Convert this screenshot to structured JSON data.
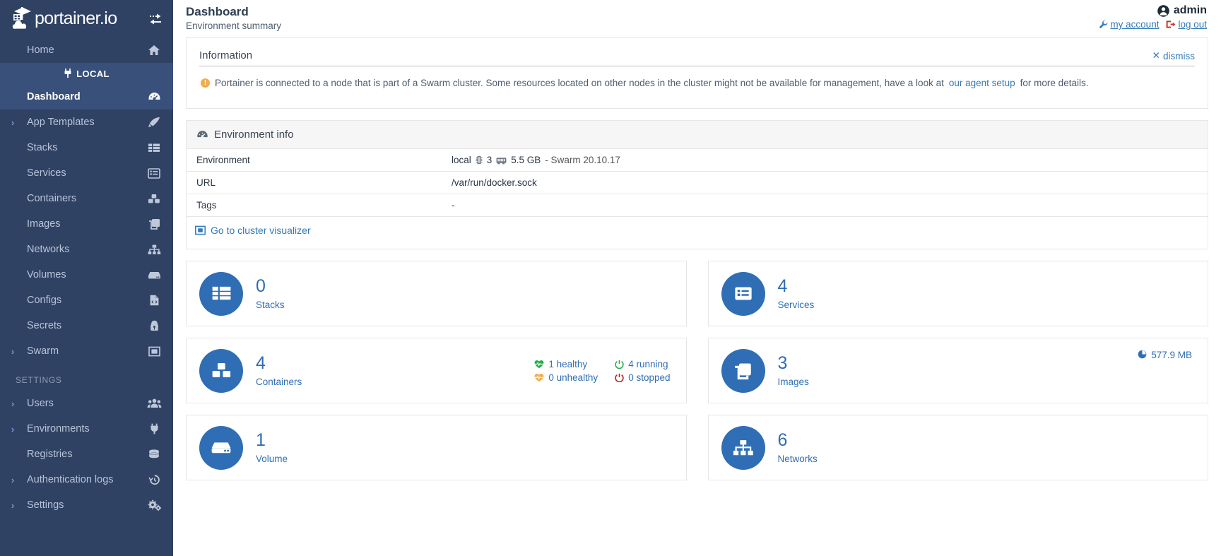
{
  "sidebar": {
    "brand": {
      "text": "portainer.io",
      "logo_icon": "portainer-whale-crane-logo",
      "toggle_icon": "collapse-sidebar-icon"
    },
    "home": {
      "label": "Home",
      "icon": "home-icon"
    },
    "env_badge": {
      "label": "LOCAL",
      "icon": "plug-icon"
    },
    "items": [
      {
        "label": "Dashboard",
        "icon": "dashboard-gauge-icon",
        "expandable": false,
        "active": true
      },
      {
        "label": "App Templates",
        "icon": "rocket-icon",
        "expandable": true,
        "active": false
      },
      {
        "label": "Stacks",
        "icon": "stacks-grid-icon",
        "expandable": false,
        "active": false
      },
      {
        "label": "Services",
        "icon": "services-list-icon",
        "expandable": false,
        "active": false
      },
      {
        "label": "Containers",
        "icon": "containers-boxes-icon",
        "expandable": false,
        "active": false
      },
      {
        "label": "Images",
        "icon": "images-copy-icon",
        "expandable": false,
        "active": false
      },
      {
        "label": "Networks",
        "icon": "networks-sitemap-icon",
        "expandable": false,
        "active": false
      },
      {
        "label": "Volumes",
        "icon": "volumes-hdd-icon",
        "expandable": false,
        "active": false
      },
      {
        "label": "Configs",
        "icon": "configs-file-code-icon",
        "expandable": false,
        "active": false
      },
      {
        "label": "Secrets",
        "icon": "secrets-lock-icon",
        "expandable": false,
        "active": false
      },
      {
        "label": "Swarm",
        "icon": "swarm-frame-icon",
        "expandable": true,
        "active": false
      }
    ],
    "settings_section": "SETTINGS",
    "settings_items": [
      {
        "label": "Users",
        "icon": "users-group-icon",
        "expandable": true
      },
      {
        "label": "Environments",
        "icon": "plug-icon",
        "expandable": true
      },
      {
        "label": "Registries",
        "icon": "registries-database-icon",
        "expandable": false
      },
      {
        "label": "Authentication logs",
        "icon": "history-clock-icon",
        "expandable": true
      },
      {
        "label": "Settings",
        "icon": "gears-icon",
        "expandable": true
      }
    ]
  },
  "header": {
    "title": "Dashboard",
    "subtitle": "Environment summary",
    "user": "admin",
    "user_icon": "user-circle-icon",
    "my_account_label": "my account",
    "my_account_icon": "wrench-icon",
    "log_out_label": "log out",
    "log_out_icon": "logout-icon"
  },
  "information": {
    "title": "Information",
    "dismiss_label": "dismiss",
    "dismiss_icon": "close-x-icon",
    "warn_icon": "warning-exclamation-icon",
    "message_before_link": "Portainer is connected to a node that is part of a Swarm cluster. Some resources located on other nodes in the cluster might not be available for management, have a look at ",
    "link_text": "our agent setup",
    "message_after_link": " for more details."
  },
  "environment_info": {
    "title": "Environment info",
    "title_icon": "dashboard-gauge-icon",
    "rows": [
      {
        "key": "Environment",
        "value": "local",
        "cpu_icon": "cpu-icon",
        "cpu": "3",
        "mem_icon": "memory-icon",
        "mem": "5.5 GB",
        "suffix": "- Swarm 20.10.17"
      },
      {
        "key": "URL",
        "value": "/var/run/docker.sock"
      },
      {
        "key": "Tags",
        "value": "-"
      }
    ],
    "cluster_visualizer_label": "Go to cluster visualizer",
    "cluster_visualizer_icon": "sitemap-frame-icon"
  },
  "cards": [
    {
      "count": "0",
      "label": "Stacks",
      "icon": "stacks-grid-icon"
    },
    {
      "count": "4",
      "label": "Services",
      "icon": "services-list-icon"
    },
    {
      "count": "4",
      "label": "Containers",
      "icon": "containers-boxes-icon",
      "stats": [
        {
          "icon": "heartbeat-green-icon",
          "text": "1 healthy",
          "color": "#23ae4b"
        },
        {
          "icon": "power-green-icon",
          "text": "4 running",
          "color": "#23ae4b"
        },
        {
          "icon": "heartbeat-orange-icon",
          "text": "0 unhealthy",
          "color": "#f0ad4e"
        },
        {
          "icon": "power-red-icon",
          "text": "0 stopped",
          "color": "#c0392b"
        }
      ]
    },
    {
      "count": "3",
      "label": "Images",
      "icon": "images-copy-icon",
      "size": "577.9 MB",
      "size_icon": "pie-chart-icon"
    },
    {
      "count": "1",
      "label": "Volume",
      "icon": "volumes-hdd-icon"
    },
    {
      "count": "6",
      "label": "Networks",
      "icon": "networks-sitemap-icon"
    }
  ],
  "colors": {
    "sidebar_bg": "#2f4263",
    "sidebar_active": "#38507a",
    "accent_blue": "#2f6eb5",
    "link_blue": "#337ab7",
    "warn_orange": "#f0ad4e",
    "danger_red": "#c0392b",
    "success_green": "#23ae4b"
  }
}
